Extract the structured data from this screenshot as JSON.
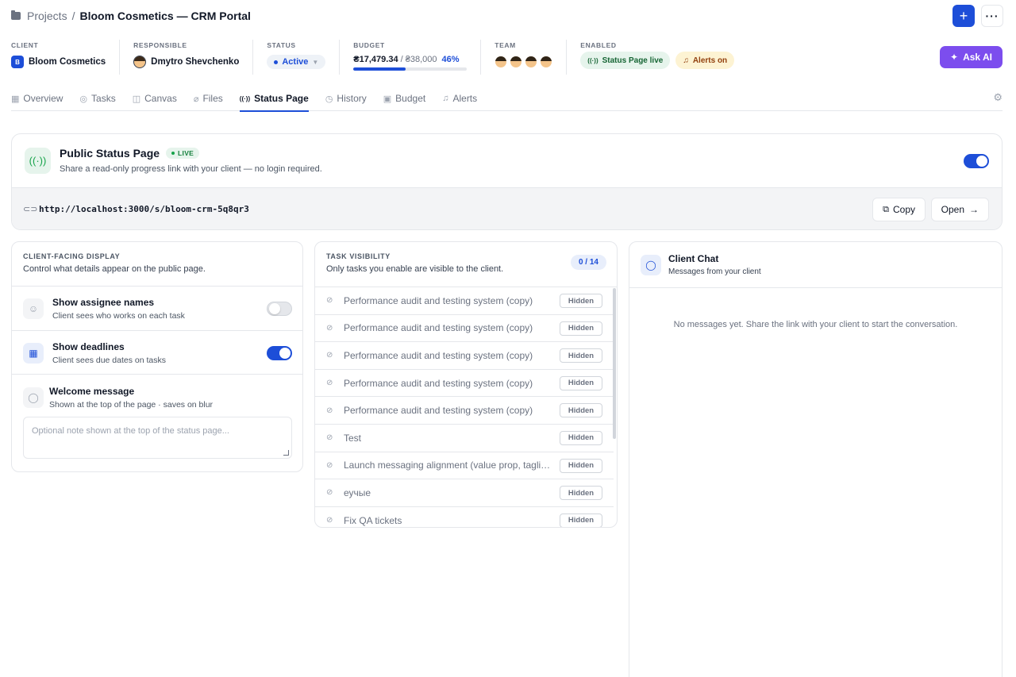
{
  "breadcrumb": {
    "projects": "Projects",
    "sep": "/",
    "title": "Bloom Cosmetics — CRM Portal"
  },
  "top_actions": {
    "add": "+",
    "more": "···"
  },
  "meta": {
    "client": {
      "label": "CLIENT",
      "initial": "B",
      "name": "Bloom Cosmetics"
    },
    "responsible": {
      "label": "RESPONSIBLE",
      "name": "Dmytro Shevchenko"
    },
    "status": {
      "label": "STATUS",
      "value": "Active"
    },
    "budget": {
      "label": "BUDGET",
      "spent": "₴17,479.34",
      "sep": " / ",
      "total": "₴38,000",
      "percent": "46%",
      "progress": 0.46
    },
    "team": {
      "label": "TEAM",
      "count": 4
    },
    "enabled": {
      "label": "ENABLED",
      "status_page": "Status Page live",
      "alerts": "Alerts on"
    }
  },
  "ask_ai": "Ask AI",
  "tabs": [
    {
      "label": "Overview",
      "icon": "grid-icon",
      "glyph": "▦"
    },
    {
      "label": "Tasks",
      "icon": "check-circle-icon",
      "glyph": "◎"
    },
    {
      "label": "Canvas",
      "icon": "book-icon",
      "glyph": "◫"
    },
    {
      "label": "Files",
      "icon": "paperclip-icon",
      "glyph": "⌀"
    },
    {
      "label": "Status Page",
      "icon": "broadcast-icon",
      "glyph": "((·))",
      "active": true
    },
    {
      "label": "History",
      "icon": "clock-icon",
      "glyph": "◷"
    },
    {
      "label": "Budget",
      "icon": "wallet-icon",
      "glyph": "▣"
    },
    {
      "label": "Alerts",
      "icon": "bell-icon",
      "glyph": "♫"
    }
  ],
  "status_page": {
    "title": "Public Status Page",
    "live": "LIVE",
    "subtitle": "Share a read-only progress link with your client — no login required.",
    "enabled": true,
    "url": "http://localhost:3000/s/bloom-crm-5q8qr3",
    "copy": "Copy",
    "open": "Open"
  },
  "display": {
    "label": "CLIENT-FACING DISPLAY",
    "subtitle": "Control what details appear on the public page.",
    "assignees": {
      "title": "Show assignee names",
      "sub": "Client sees who works on each task",
      "on": false
    },
    "deadlines": {
      "title": "Show deadlines",
      "sub": "Client sees due dates on tasks",
      "on": true
    },
    "welcome": {
      "title": "Welcome message",
      "sub": "Shown at the top of the page · saves on blur",
      "placeholder": "Optional note shown at the top of the status page..."
    }
  },
  "visibility": {
    "label": "TASK VISIBILITY",
    "subtitle": "Only tasks you enable are visible to the client.",
    "count": "0 / 14",
    "hidden_label": "Hidden",
    "tasks": [
      "Performance audit and testing system (copy)",
      "Performance audit and testing system (copy)",
      "Performance audit and testing system (copy)",
      "Performance audit and testing system (copy)",
      "Performance audit and testing system (copy)",
      "Test",
      "Launch messaging alignment (value prop, taglines)",
      "еучые",
      "Fix QA tickets"
    ]
  },
  "chat": {
    "title": "Client Chat",
    "subtitle": "Messages from your client",
    "empty": "No messages yet. Share the link with your client to start the conversation."
  }
}
